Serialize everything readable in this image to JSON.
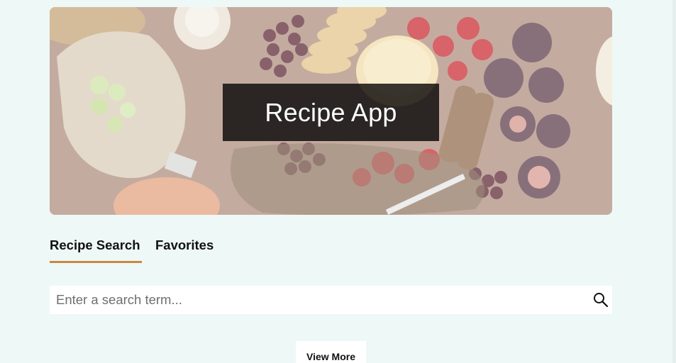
{
  "hero": {
    "title": "Recipe App"
  },
  "tabs": [
    {
      "label": "Recipe Search",
      "active": true
    },
    {
      "label": "Favorites",
      "active": false
    }
  ],
  "search": {
    "placeholder": "Enter a search term...",
    "value": "",
    "icon": "search-icon"
  },
  "actions": {
    "view_more_label": "View More"
  },
  "colors": {
    "background": "#eef8f7",
    "tab_underline": "#c8893f",
    "title_box": "#000000"
  }
}
